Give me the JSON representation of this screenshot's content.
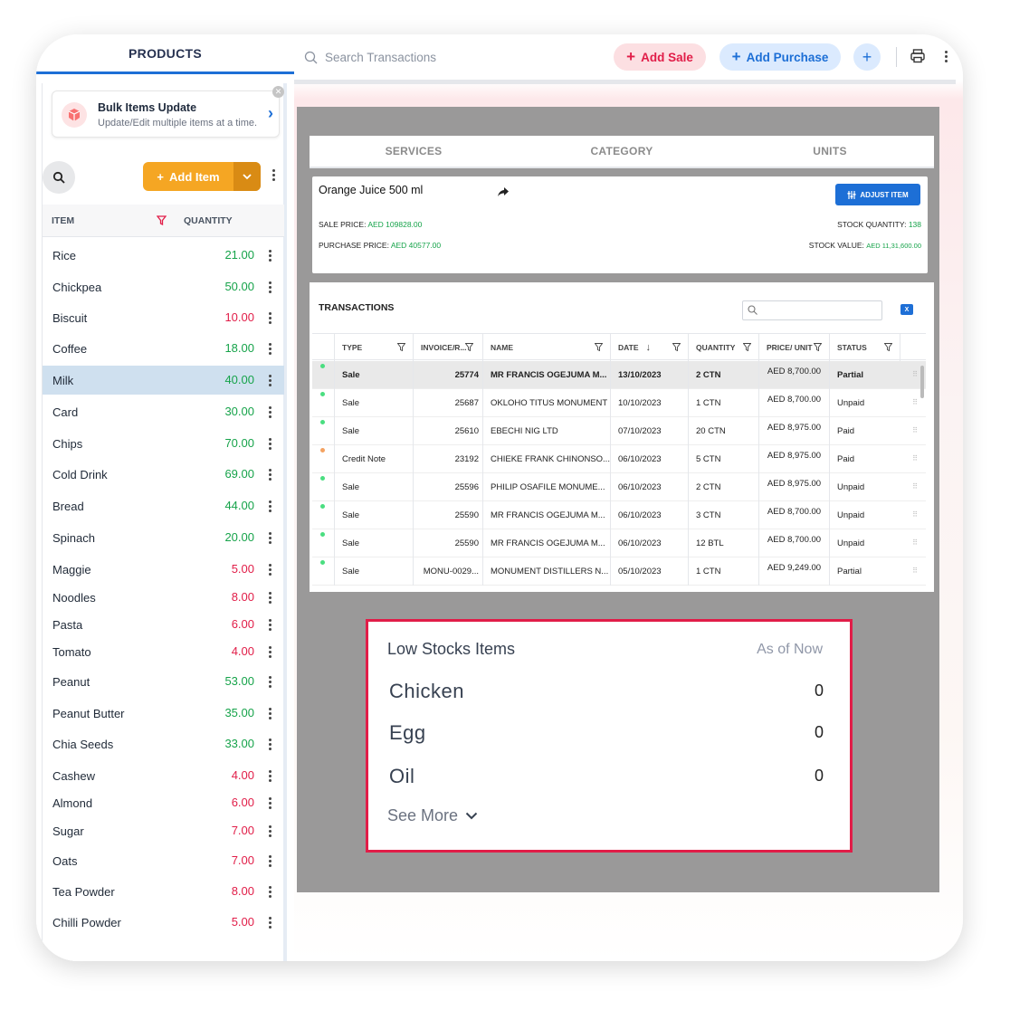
{
  "left_panel": {
    "title": "PRODUCTS",
    "bulk_card": {
      "title": "Bulk Items Update",
      "subtitle": "Update/Edit multiple items at a time."
    },
    "add_item_label": "Add Item",
    "columns": {
      "item": "ITEM",
      "quantity": "QUANTITY"
    },
    "items": [
      {
        "name": "Rice",
        "qty": "21.00",
        "status": "ok"
      },
      {
        "name": "Chickpea",
        "qty": "50.00",
        "status": "ok"
      },
      {
        "name": "Biscuit",
        "qty": "10.00",
        "status": "low"
      },
      {
        "name": "Coffee",
        "qty": "18.00",
        "status": "ok"
      },
      {
        "name": "Milk",
        "qty": "40.00",
        "status": "ok",
        "selected": true
      },
      {
        "name": "Card",
        "qty": "30.00",
        "status": "ok"
      },
      {
        "name": "Chips",
        "qty": "70.00",
        "status": "ok"
      },
      {
        "name": "Cold Drink",
        "qty": "69.00",
        "status": "ok"
      },
      {
        "name": "Bread",
        "qty": "44.00",
        "status": "ok"
      },
      {
        "name": "Spinach",
        "qty": "20.00",
        "status": "ok"
      },
      {
        "name": "Maggie",
        "qty": "5.00",
        "status": "low"
      },
      {
        "name": "Noodles",
        "qty": "8.00",
        "status": "low"
      },
      {
        "name": "Pasta",
        "qty": "6.00",
        "status": "low"
      },
      {
        "name": "Tomato",
        "qty": "4.00",
        "status": "low"
      },
      {
        "name": "Peanut",
        "qty": "53.00",
        "status": "ok"
      },
      {
        "name": "Peanut Butter",
        "qty": "35.00",
        "status": "ok"
      },
      {
        "name": "Chia Seeds",
        "qty": "33.00",
        "status": "ok"
      },
      {
        "name": "Cashew",
        "qty": "4.00",
        "status": "low"
      },
      {
        "name": "Almond",
        "qty": "6.00",
        "status": "low"
      },
      {
        "name": "Sugar",
        "qty": "7.00",
        "status": "low"
      },
      {
        "name": "Oats",
        "qty": "7.00",
        "status": "low"
      },
      {
        "name": "Tea Powder",
        "qty": "8.00",
        "status": "low"
      },
      {
        "name": "Chilli Powder",
        "qty": "5.00",
        "status": "low"
      }
    ]
  },
  "topbar": {
    "search_placeholder": "Search Transactions",
    "add_sale": "Add Sale",
    "add_purchase": "Add Purchase"
  },
  "tabs": [
    "SERVICES",
    "CATEGORY",
    "UNITS"
  ],
  "item_detail": {
    "name": "Orange Juice 500 ml",
    "adjust_label": "ADJUST ITEM",
    "sale_price_label": "SALE PRICE:",
    "sale_price": "AED 109828.00",
    "purchase_price_label": "PURCHASE PRICE:",
    "purchase_price": "AED 40577.00",
    "stock_qty_label": "STOCK QUANTITY:",
    "stock_qty": "138",
    "stock_value_label": "STOCK VALUE:",
    "stock_value": "AED 11,31,600.00"
  },
  "transactions": {
    "title": "TRANSACTIONS",
    "columns": [
      "TYPE",
      "INVOICE/R...",
      "NAME",
      "DATE",
      "QUANTITY",
      "PRICE/ UNIT",
      "STATUS"
    ],
    "rows": [
      {
        "type": "Sale",
        "invoice": "25774",
        "name": "MR FRANCIS OGEJUMA M...",
        "date": "13/10/2023",
        "qty": "2 CTN",
        "price": "AED 8,700.00",
        "status": "Partial",
        "dot": "green"
      },
      {
        "type": "Sale",
        "invoice": "25687",
        "name": "OKLOHO TITUS MONUMENT",
        "date": "10/10/2023",
        "qty": "1 CTN",
        "price": "AED 8,700.00",
        "status": "Unpaid",
        "dot": "green"
      },
      {
        "type": "Sale",
        "invoice": "25610",
        "name": "EBECHI NIG LTD",
        "date": "07/10/2023",
        "qty": "20 CTN",
        "price": "AED 8,975.00",
        "status": "Paid",
        "dot": "green"
      },
      {
        "type": "Credit Note",
        "invoice": "23192",
        "name": "CHIEKE FRANK CHINONSO...",
        "date": "06/10/2023",
        "qty": "5 CTN",
        "price": "AED 8,975.00",
        "status": "Paid",
        "dot": "orange"
      },
      {
        "type": "Sale",
        "invoice": "25596",
        "name": "PHILIP OSAFILE MONUME...",
        "date": "06/10/2023",
        "qty": "2 CTN",
        "price": "AED 8,975.00",
        "status": "Unpaid",
        "dot": "green"
      },
      {
        "type": "Sale",
        "invoice": "25590",
        "name": "MR FRANCIS OGEJUMA M...",
        "date": "06/10/2023",
        "qty": "3 CTN",
        "price": "AED 8,700.00",
        "status": "Unpaid",
        "dot": "green"
      },
      {
        "type": "Sale",
        "invoice": "25590",
        "name": "MR FRANCIS OGEJUMA M...",
        "date": "06/10/2023",
        "qty": "12 BTL",
        "price": "AED 8,700.00",
        "status": "Unpaid",
        "dot": "green"
      },
      {
        "type": "Sale",
        "invoice": "MONU-0029...",
        "name": "MONUMENT DISTILLERS N...",
        "date": "05/10/2023",
        "qty": "1 CTN",
        "price": "AED 9,249.00",
        "status": "Partial",
        "dot": "green"
      }
    ]
  },
  "low_stocks": {
    "title": "Low Stocks Items",
    "as_of": "As of Now",
    "items": [
      {
        "name": "Chicken",
        "qty": "0"
      },
      {
        "name": "Egg",
        "qty": "0"
      },
      {
        "name": "Oil",
        "qty": "0"
      }
    ],
    "see_more": "See More"
  },
  "colors": {
    "accent_blue": "#1d6fd6",
    "orange": "#f5a623",
    "green": "#16a34a",
    "red": "#e11d48",
    "overlay": "#9a9999"
  }
}
